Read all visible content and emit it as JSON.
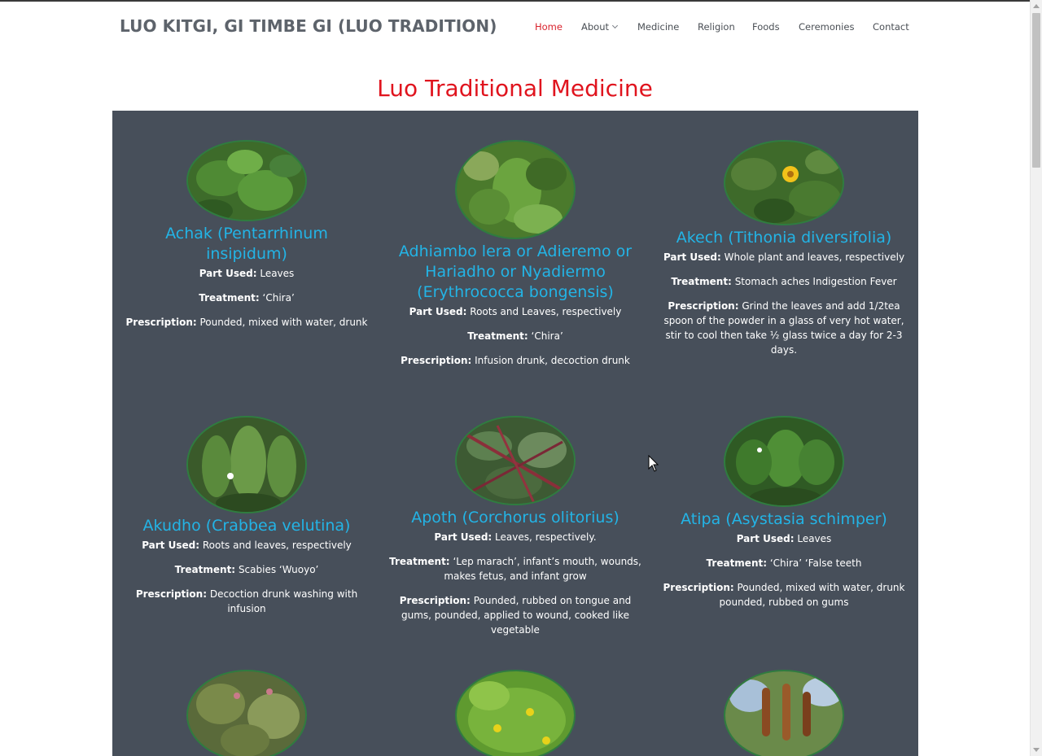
{
  "header": {
    "brand": "LUO KITGI, GI TIMBE GI (LUO TRADITION)",
    "nav": [
      {
        "label": "Home",
        "active": true
      },
      {
        "label": "About",
        "dropdown": true
      },
      {
        "label": "Medicine"
      },
      {
        "label": "Religion"
      },
      {
        "label": "Foods"
      },
      {
        "label": "Ceremonies"
      },
      {
        "label": "Contact"
      }
    ]
  },
  "main": {
    "title": "Luo Traditional Medicine",
    "labels": {
      "part_used": "Part Used:",
      "treatment": "Treatment:",
      "prescription": "Prescription:"
    },
    "plants": [
      {
        "name": "Achak (Pentarrhinum insipidum)",
        "part_used": "Leaves",
        "treatment": "‘Chira’",
        "prescription": "Pounded, mixed with water, drunk"
      },
      {
        "name": "Adhiambo lera or Adieremo or Hariadho or Nyadiermo (Erythrococca bongensis)",
        "part_used": "Roots and Leaves, respectively",
        "treatment": "‘Chira’",
        "prescription": "Infusion drunk, decoction drunk"
      },
      {
        "name": "Akech (Tithonia diversifolia)",
        "part_used": "Whole plant and leaves, respectively",
        "treatment": "Stomach aches Indigestion Fever",
        "prescription": "Grind the leaves and add 1/2tea spoon of the powder in a glass of very hot water, stir to cool then take ½ glass twice a day for 2-3 days."
      },
      {
        "name": "Akudho (Crabbea velutina)",
        "part_used": "Roots and leaves, respectively",
        "treatment": "Scabies ‘Wuoyo’",
        "prescription": "Decoction drunk washing with infusion"
      },
      {
        "name": "Apoth (Corchorus olitorius)",
        "part_used": "Leaves, respectively.",
        "treatment": "‘Lep marach’, infant’s mouth, wounds, makes fetus, and infant grow",
        "prescription": "Pounded, rubbed on tongue and gums, pounded, applied to wound, cooked like vegetable"
      },
      {
        "name": "Atipa (Asystasia schimper)",
        "part_used": "Leaves",
        "treatment": "‘Chira’ ‘False teeth",
        "prescription": "Pounded, mixed with water, drunk pounded, rubbed on gums"
      }
    ]
  },
  "colors": {
    "title": "#e0141e",
    "nav_active": "#d9232d",
    "panel": "#474f5a",
    "plant_name": "#23b4e6",
    "image_border": "#2f7d3f"
  }
}
